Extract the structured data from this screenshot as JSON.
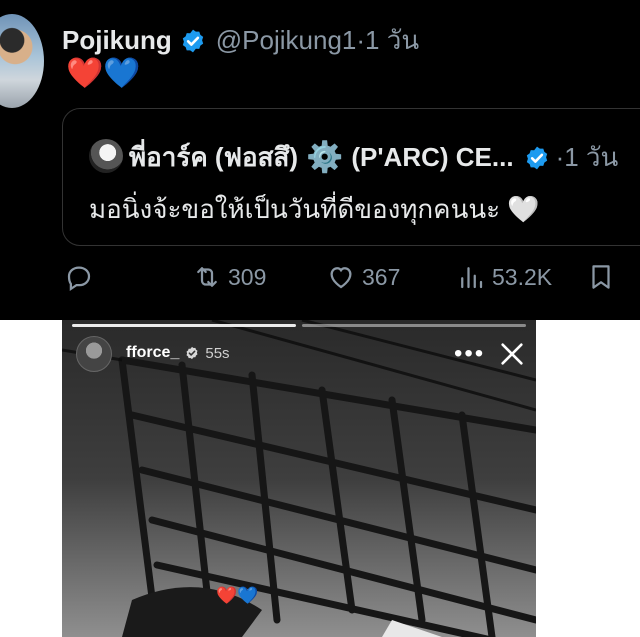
{
  "tweet": {
    "author_name": "Pojikung",
    "handle": "@Pojikung1",
    "separator": "·",
    "time": "1 วัน",
    "body": "❤️💙",
    "quote": {
      "author_name": "พี่อาร์ค (ฟอสสึ)",
      "gear_glyph": "⚙️",
      "author_name2": "(P'ARC) CE...",
      "separator": "·",
      "time": "1 วัน",
      "text": "มอนิ่งจ้ะขอให้เป็นวันที่ดีของทุกคนนะ 🤍"
    },
    "actions": {
      "reply_icon": "reply-icon",
      "retweet_icon": "retweet-icon",
      "retweet_count": "309",
      "like_icon": "heart-icon",
      "like_count": "367",
      "views_icon": "views-icon",
      "views_count": "53.2K",
      "bookmark_icon": "bookmark-icon"
    }
  },
  "story": {
    "username": "fforce_",
    "time": "55s",
    "more_glyph": "•••",
    "hearts": "❤️💙",
    "progress": [
      1,
      0
    ]
  },
  "colors": {
    "tweet_bg": "#000000",
    "verified_blue": "#1d9bf0",
    "muted_text": "#8b98a5"
  }
}
